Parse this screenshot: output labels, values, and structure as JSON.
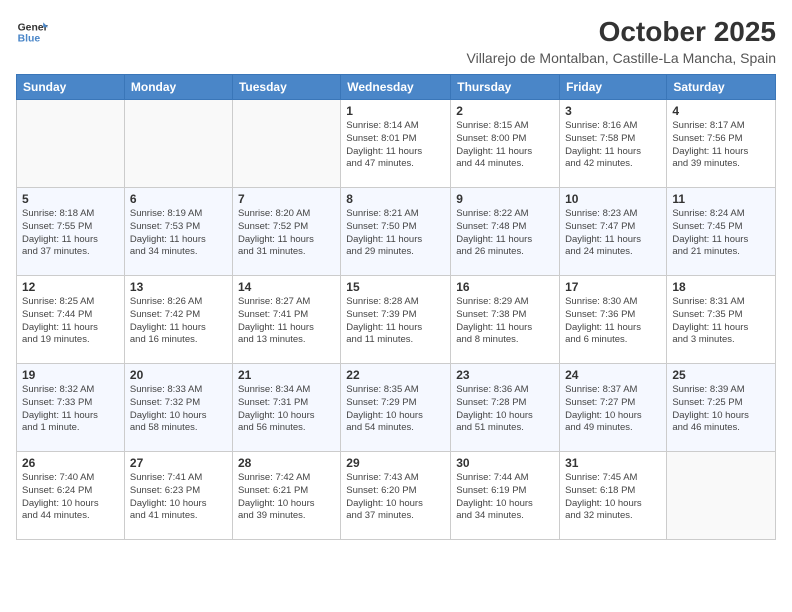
{
  "logo": {
    "line1": "General",
    "line2": "Blue"
  },
  "title": "October 2025",
  "subtitle": "Villarejo de Montalban, Castille-La Mancha, Spain",
  "days_of_week": [
    "Sunday",
    "Monday",
    "Tuesday",
    "Wednesday",
    "Thursday",
    "Friday",
    "Saturday"
  ],
  "weeks": [
    [
      {
        "day": "",
        "info": ""
      },
      {
        "day": "",
        "info": ""
      },
      {
        "day": "",
        "info": ""
      },
      {
        "day": "1",
        "info": "Sunrise: 8:14 AM\nSunset: 8:01 PM\nDaylight: 11 hours\nand 47 minutes."
      },
      {
        "day": "2",
        "info": "Sunrise: 8:15 AM\nSunset: 8:00 PM\nDaylight: 11 hours\nand 44 minutes."
      },
      {
        "day": "3",
        "info": "Sunrise: 8:16 AM\nSunset: 7:58 PM\nDaylight: 11 hours\nand 42 minutes."
      },
      {
        "day": "4",
        "info": "Sunrise: 8:17 AM\nSunset: 7:56 PM\nDaylight: 11 hours\nand 39 minutes."
      }
    ],
    [
      {
        "day": "5",
        "info": "Sunrise: 8:18 AM\nSunset: 7:55 PM\nDaylight: 11 hours\nand 37 minutes."
      },
      {
        "day": "6",
        "info": "Sunrise: 8:19 AM\nSunset: 7:53 PM\nDaylight: 11 hours\nand 34 minutes."
      },
      {
        "day": "7",
        "info": "Sunrise: 8:20 AM\nSunset: 7:52 PM\nDaylight: 11 hours\nand 31 minutes."
      },
      {
        "day": "8",
        "info": "Sunrise: 8:21 AM\nSunset: 7:50 PM\nDaylight: 11 hours\nand 29 minutes."
      },
      {
        "day": "9",
        "info": "Sunrise: 8:22 AM\nSunset: 7:48 PM\nDaylight: 11 hours\nand 26 minutes."
      },
      {
        "day": "10",
        "info": "Sunrise: 8:23 AM\nSunset: 7:47 PM\nDaylight: 11 hours\nand 24 minutes."
      },
      {
        "day": "11",
        "info": "Sunrise: 8:24 AM\nSunset: 7:45 PM\nDaylight: 11 hours\nand 21 minutes."
      }
    ],
    [
      {
        "day": "12",
        "info": "Sunrise: 8:25 AM\nSunset: 7:44 PM\nDaylight: 11 hours\nand 19 minutes."
      },
      {
        "day": "13",
        "info": "Sunrise: 8:26 AM\nSunset: 7:42 PM\nDaylight: 11 hours\nand 16 minutes."
      },
      {
        "day": "14",
        "info": "Sunrise: 8:27 AM\nSunset: 7:41 PM\nDaylight: 11 hours\nand 13 minutes."
      },
      {
        "day": "15",
        "info": "Sunrise: 8:28 AM\nSunset: 7:39 PM\nDaylight: 11 hours\nand 11 minutes."
      },
      {
        "day": "16",
        "info": "Sunrise: 8:29 AM\nSunset: 7:38 PM\nDaylight: 11 hours\nand 8 minutes."
      },
      {
        "day": "17",
        "info": "Sunrise: 8:30 AM\nSunset: 7:36 PM\nDaylight: 11 hours\nand 6 minutes."
      },
      {
        "day": "18",
        "info": "Sunrise: 8:31 AM\nSunset: 7:35 PM\nDaylight: 11 hours\nand 3 minutes."
      }
    ],
    [
      {
        "day": "19",
        "info": "Sunrise: 8:32 AM\nSunset: 7:33 PM\nDaylight: 11 hours\nand 1 minute."
      },
      {
        "day": "20",
        "info": "Sunrise: 8:33 AM\nSunset: 7:32 PM\nDaylight: 10 hours\nand 58 minutes."
      },
      {
        "day": "21",
        "info": "Sunrise: 8:34 AM\nSunset: 7:31 PM\nDaylight: 10 hours\nand 56 minutes."
      },
      {
        "day": "22",
        "info": "Sunrise: 8:35 AM\nSunset: 7:29 PM\nDaylight: 10 hours\nand 54 minutes."
      },
      {
        "day": "23",
        "info": "Sunrise: 8:36 AM\nSunset: 7:28 PM\nDaylight: 10 hours\nand 51 minutes."
      },
      {
        "day": "24",
        "info": "Sunrise: 8:37 AM\nSunset: 7:27 PM\nDaylight: 10 hours\nand 49 minutes."
      },
      {
        "day": "25",
        "info": "Sunrise: 8:39 AM\nSunset: 7:25 PM\nDaylight: 10 hours\nand 46 minutes."
      }
    ],
    [
      {
        "day": "26",
        "info": "Sunrise: 7:40 AM\nSunset: 6:24 PM\nDaylight: 10 hours\nand 44 minutes."
      },
      {
        "day": "27",
        "info": "Sunrise: 7:41 AM\nSunset: 6:23 PM\nDaylight: 10 hours\nand 41 minutes."
      },
      {
        "day": "28",
        "info": "Sunrise: 7:42 AM\nSunset: 6:21 PM\nDaylight: 10 hours\nand 39 minutes."
      },
      {
        "day": "29",
        "info": "Sunrise: 7:43 AM\nSunset: 6:20 PM\nDaylight: 10 hours\nand 37 minutes."
      },
      {
        "day": "30",
        "info": "Sunrise: 7:44 AM\nSunset: 6:19 PM\nDaylight: 10 hours\nand 34 minutes."
      },
      {
        "day": "31",
        "info": "Sunrise: 7:45 AM\nSunset: 6:18 PM\nDaylight: 10 hours\nand 32 minutes."
      },
      {
        "day": "",
        "info": ""
      }
    ]
  ]
}
